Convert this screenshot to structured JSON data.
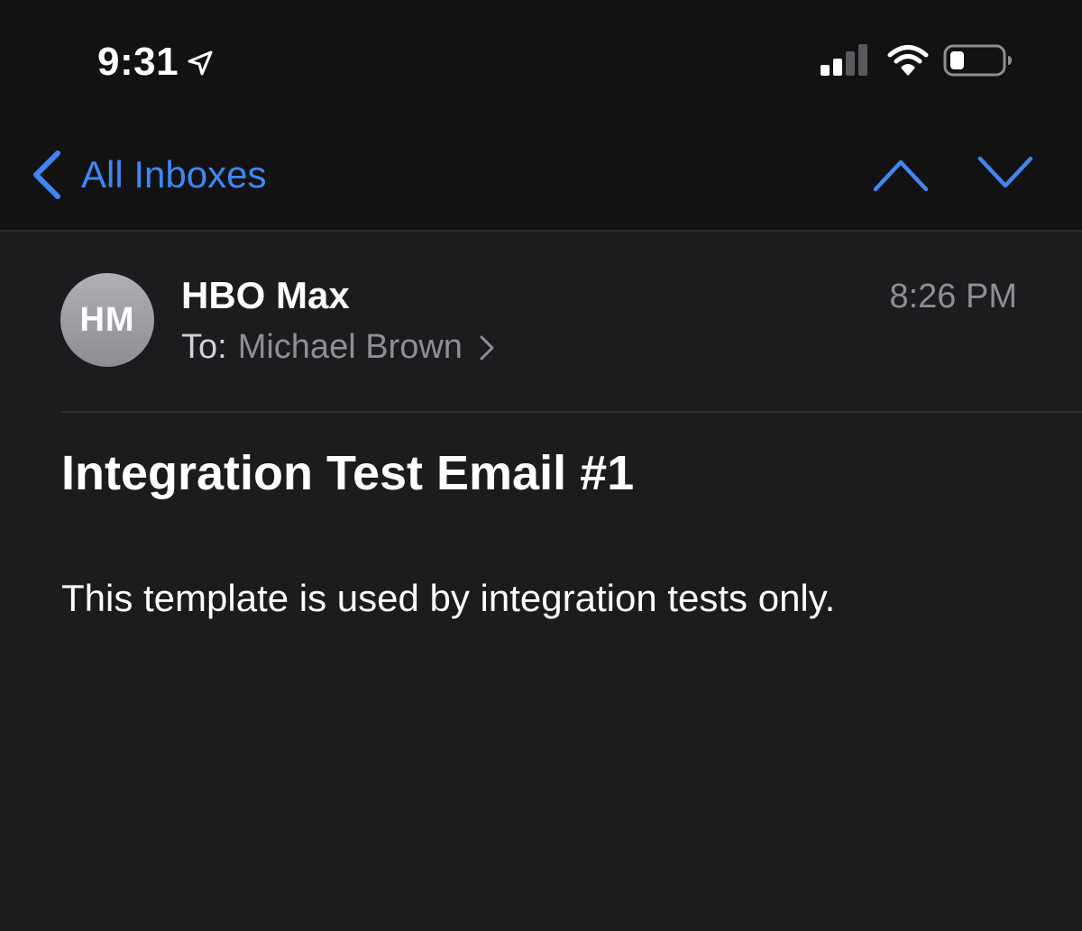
{
  "status_bar": {
    "time": "9:31",
    "icons": [
      "location-arrow-icon",
      "signal-icon",
      "wifi-icon",
      "battery-icon"
    ]
  },
  "nav": {
    "back_label": "All Inboxes",
    "icons": [
      "chevron-left-icon",
      "chevron-up-icon",
      "chevron-down-icon"
    ]
  },
  "message": {
    "avatar_initials": "HM",
    "sender": "HBO Max",
    "time": "8:26 PM",
    "to_prefix": "To:",
    "recipient": "Michael Brown",
    "subject": "Integration Test Email #1",
    "body": "This template is used by integration tests only."
  },
  "colors": {
    "accent": "#3f87f5",
    "background": "#1c1c1e",
    "topbar": "#121212",
    "secondary_text": "#8e8e93"
  }
}
